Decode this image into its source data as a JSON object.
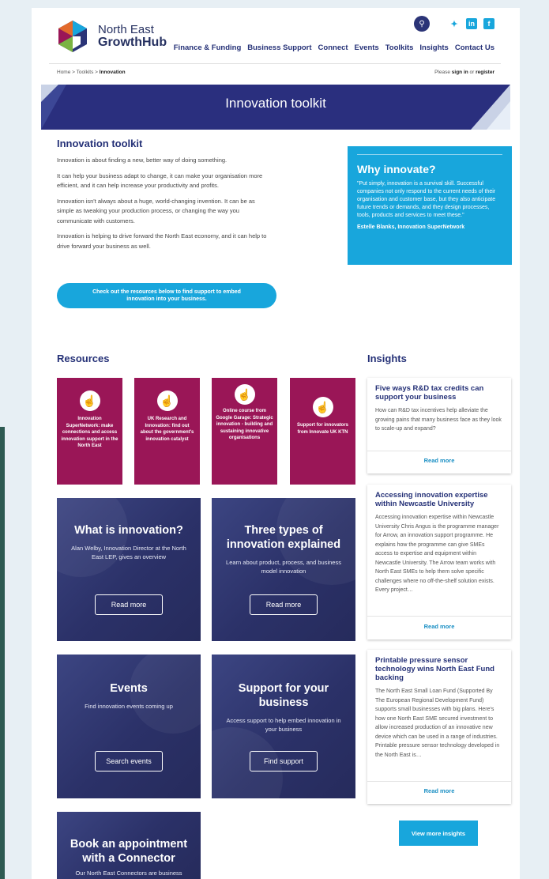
{
  "header": {
    "logo_line1": "North East",
    "logo_line2": "GrowthHub",
    "nav": [
      "Finance & Funding",
      "Business Support",
      "Connect",
      "Events",
      "Toolkits",
      "Insights",
      "Contact Us"
    ],
    "social": [
      "twitter-icon",
      "linkedin-icon",
      "facebook-icon"
    ]
  },
  "breadcrumb": {
    "home": "Home",
    "toolkits": "Toolkits",
    "current": "Innovation",
    "sep": ">"
  },
  "auth": {
    "prefix": "Please",
    "signin": "sign in",
    "or": "or",
    "register": "register"
  },
  "banner": {
    "title": "Innovation toolkit"
  },
  "intro": {
    "title": "Innovation toolkit",
    "paragraphs": [
      "Innovation is about finding a new, better way of doing something.",
      "It can help your business adapt to change, it can make your organisation more efficient, and it can help increase your productivity and profits.",
      "Innovation isn't always about a huge, world-changing invention. It can be as simple as tweaking your production process, or changing the way you communicate with customers.",
      "Innovation is helping to drive forward the North East economy, and it can help to drive forward your business as well."
    ],
    "cta": "Check out the resources below to find support to embed innovation into your business."
  },
  "why": {
    "title": "Why innovate?",
    "quote": "\"Put simply, innovation is a survival skill. Successful companies not only respond to the current needs of their organisation and customer base, but they also anticipate future trends or demands, and they design processes, tools, products and services to meet these.\"",
    "author": "Estelle Blanks, Innovation SuperNetwork"
  },
  "resources": {
    "title": "Resources",
    "cards": [
      {
        "label": "Innovation SuperNetwork: make connections and access innovation support in the North East"
      },
      {
        "label": "UK Research and Innovation: find out about the government's innovation catalyst"
      },
      {
        "label": "Online course from Google Garage: Strategic innovation - building and sustaining innovative organisations"
      },
      {
        "label": "Support for innovators from Innovate UK KTN"
      }
    ],
    "tiles": [
      {
        "title": "What is innovation?",
        "text": "Alan Welby, Innovation Director at the North East LEP, gives an overview",
        "button": "Read more"
      },
      {
        "title": "Three types of innovation explained",
        "text": "Learn about product, process, and business model innovation",
        "button": "Read more"
      },
      {
        "title": "Events",
        "text": "Find innovation events coming up",
        "button": "Search events"
      },
      {
        "title": "Support for your business",
        "text": "Access support to help embed innovation in your business",
        "button": "Find support"
      },
      {
        "title": "Book an appointment with a Connector",
        "text": "Our North East Connectors are business"
      }
    ]
  },
  "insights": {
    "title": "Insights",
    "items": [
      {
        "title": "Five ways R&D tax credits can support your business",
        "text": "How can R&D tax incentives help alleviate the growing pains that many business face as they look to scale-up and expand?",
        "more": "Read more"
      },
      {
        "title": "Accessing innovation expertise within Newcastle University",
        "text": "Accessing innovation expertise within Newcastle University Chris Angus is the programme manager for Arrow, an innovation support programme. He explains how the programme can give SMEs access to expertise and equipment within Newcastle University. The Arrow team works with North East SMEs to help them solve specific challenges where no off-the-shelf solution exists. Every project…",
        "more": "Read more"
      },
      {
        "title": "Printable pressure sensor technology wins North East Fund backing",
        "text": "The North East Small Loan Fund (Supported By The European Regional Development Fund) supports small businesses with big plans. Here's how one North East SME secured investment to allow increased production of an innovative new device which can be used in a range of industries. Printable pressure sensor technology developed in the North East is…",
        "more": "Read more"
      }
    ],
    "view_more": "View more insights"
  },
  "colors": {
    "navy": "#253177",
    "cyan": "#18a6dc",
    "magenta": "#9a1657",
    "tile": "#2b3168"
  }
}
